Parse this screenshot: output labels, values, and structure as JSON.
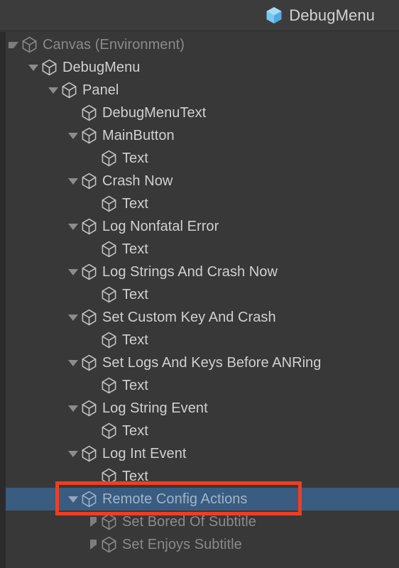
{
  "header": {
    "title": "DebugMenu",
    "icon": "prefab-cube-icon"
  },
  "colors": {
    "header_bg": "#3c3c3c",
    "panel_bg": "#383838",
    "gutter": "#2b2b2b",
    "selection_blue": "#3a5c80",
    "annotation_red": "#f03e22",
    "text_normal": "#d0d0d0",
    "text_dim": "#8a8a8a",
    "text_selected": "#9fb4ca",
    "prefab_blue": "#6fc0ef"
  },
  "hierarchy": {
    "rows": [
      {
        "label": "Canvas (Environment)",
        "depth": 0,
        "twisty": "down",
        "state": "dim",
        "icon": "cube-icon"
      },
      {
        "label": "DebugMenu",
        "depth": 1,
        "twisty": "down",
        "state": "normal",
        "icon": "cube-icon"
      },
      {
        "label": "Panel",
        "depth": 2,
        "twisty": "down",
        "state": "normal",
        "icon": "cube-icon"
      },
      {
        "label": "DebugMenuText",
        "depth": 3,
        "twisty": "none",
        "state": "normal",
        "icon": "cube-icon"
      },
      {
        "label": "MainButton",
        "depth": 3,
        "twisty": "down",
        "state": "normal",
        "icon": "cube-icon"
      },
      {
        "label": "Text",
        "depth": 4,
        "twisty": "none",
        "state": "normal",
        "icon": "cube-icon"
      },
      {
        "label": "Crash Now",
        "depth": 3,
        "twisty": "down",
        "state": "normal",
        "icon": "cube-icon"
      },
      {
        "label": "Text",
        "depth": 4,
        "twisty": "none",
        "state": "normal",
        "icon": "cube-icon"
      },
      {
        "label": "Log Nonfatal Error",
        "depth": 3,
        "twisty": "down",
        "state": "normal",
        "icon": "cube-icon"
      },
      {
        "label": "Text",
        "depth": 4,
        "twisty": "none",
        "state": "normal",
        "icon": "cube-icon"
      },
      {
        "label": "Log Strings And Crash Now",
        "depth": 3,
        "twisty": "down",
        "state": "normal",
        "icon": "cube-icon"
      },
      {
        "label": "Text",
        "depth": 4,
        "twisty": "none",
        "state": "normal",
        "icon": "cube-icon"
      },
      {
        "label": "Set Custom Key And Crash",
        "depth": 3,
        "twisty": "down",
        "state": "normal",
        "icon": "cube-icon"
      },
      {
        "label": "Text",
        "depth": 4,
        "twisty": "none",
        "state": "normal",
        "icon": "cube-icon"
      },
      {
        "label": "Set Logs And Keys Before ANRing",
        "depth": 3,
        "twisty": "down",
        "state": "normal",
        "icon": "cube-icon"
      },
      {
        "label": "Text",
        "depth": 4,
        "twisty": "none",
        "state": "normal",
        "icon": "cube-icon"
      },
      {
        "label": "Log String Event",
        "depth": 3,
        "twisty": "down",
        "state": "normal",
        "icon": "cube-icon"
      },
      {
        "label": "Text",
        "depth": 4,
        "twisty": "none",
        "state": "normal",
        "icon": "cube-icon"
      },
      {
        "label": "Log Int Event",
        "depth": 3,
        "twisty": "down",
        "state": "normal",
        "icon": "cube-icon"
      },
      {
        "label": "Text",
        "depth": 4,
        "twisty": "none",
        "state": "normal",
        "icon": "cube-icon"
      },
      {
        "label": "Remote Config Actions",
        "depth": 3,
        "twisty": "down",
        "state": "selected",
        "icon": "cube-icon"
      },
      {
        "label": "Set Bored Of Subtitle",
        "depth": 4,
        "twisty": "right",
        "state": "dim",
        "icon": "cube-icon"
      },
      {
        "label": "Set Enjoys Subtitle",
        "depth": 4,
        "twisty": "right",
        "state": "dim",
        "icon": "cube-icon"
      }
    ]
  },
  "annotation": {
    "target_row_label": "Remote Config Actions",
    "shape": "rectangle",
    "color": "#f03e22"
  }
}
